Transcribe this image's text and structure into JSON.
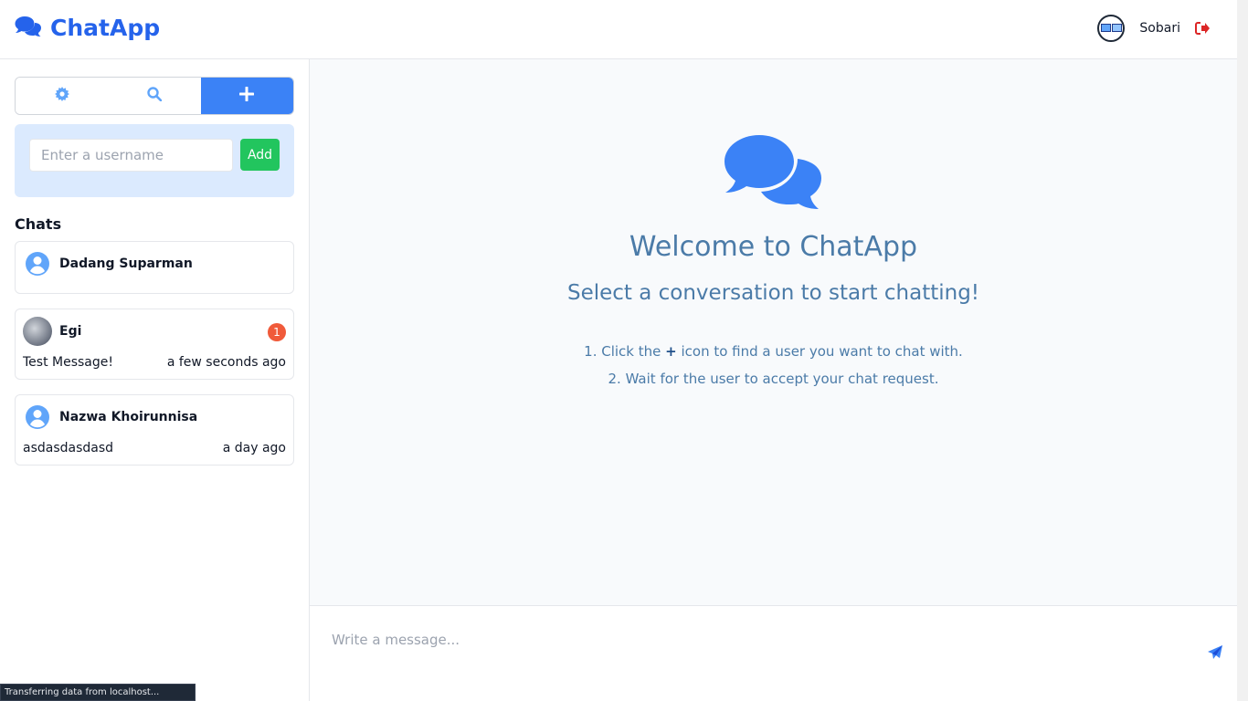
{
  "header": {
    "brand_icon": "comments-icon",
    "brand_name": "ChatApp",
    "user_name": "Sobari",
    "logout_icon": "sign-out-icon"
  },
  "sidebar": {
    "tabs": [
      {
        "icon": "gear-icon",
        "active": false
      },
      {
        "icon": "search-icon",
        "active": false
      },
      {
        "icon": "plus-icon",
        "active": true
      }
    ],
    "add_user": {
      "placeholder": "Enter a username",
      "value": "",
      "button_label": "Add"
    },
    "chats_title": "Chats",
    "chats": [
      {
        "name": "Dadang Suparman",
        "message": "",
        "time": "",
        "unread": "",
        "avatar": "user-circle-icon"
      },
      {
        "name": "Egi",
        "message": "Test Message!",
        "time": "a few seconds ago",
        "unread": "1",
        "avatar": "photo"
      },
      {
        "name": "Nazwa Khoirunnisa",
        "message": "asdasdasdasd",
        "time": "a day ago",
        "unread": "",
        "avatar": "user-circle-icon"
      }
    ]
  },
  "main": {
    "hero_icon": "comments-icon",
    "welcome": "Welcome to ChatApp",
    "subtitle": "Select a conversation to start chatting!",
    "instructions": [
      {
        "prefix": "1. Click the ",
        "bold": "+",
        "suffix": " icon to find a user you want to chat with."
      },
      {
        "prefix": "2. Wait for the user to accept your chat request.",
        "bold": "",
        "suffix": ""
      }
    ]
  },
  "composer": {
    "placeholder": "Write a message...",
    "value": "",
    "send_icon": "paper-plane-icon"
  },
  "status_bar": {
    "text": "Transferring data from localhost..."
  },
  "colors": {
    "brand": "#2563eb",
    "tab_active": "#3b82f6",
    "add_button": "#22c55e",
    "badge": "#f05a3a",
    "logout": "#dc2626",
    "welcome_text": "#4b7ba8"
  }
}
